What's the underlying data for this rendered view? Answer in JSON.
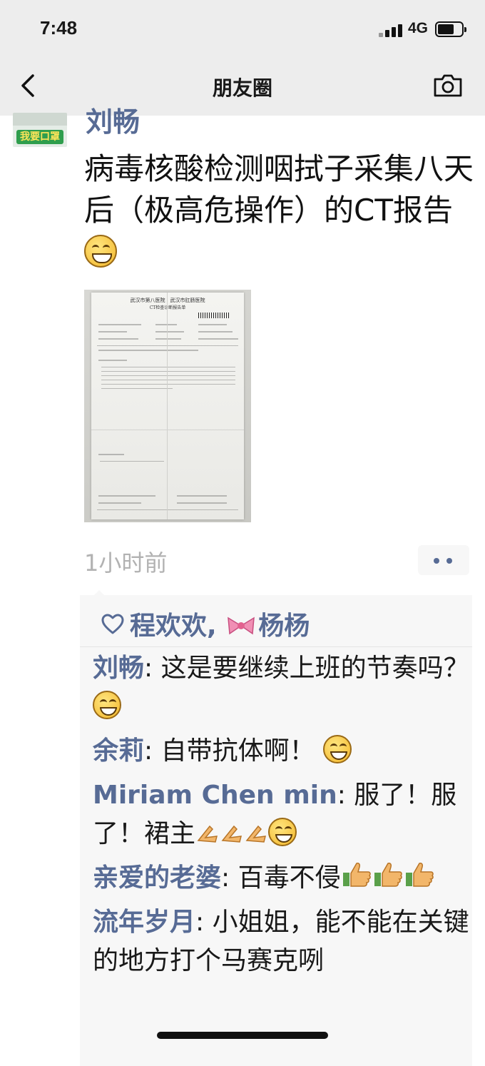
{
  "status_bar": {
    "time": "7:48",
    "network": "4G"
  },
  "nav": {
    "title": "朋友圈"
  },
  "post": {
    "avatar_label": "我要口罩",
    "author": "刘畅",
    "text": "病毒核酸检测咽拭子采集八天后（极高危操作）的CT报告",
    "time_ago": "1小时前",
    "report_header_1": "武汉市第八医院　武汉市肛肠医院",
    "report_header_2": "CT检查诊断报告单"
  },
  "likes": {
    "names": "程欢欢, ",
    "name2": "杨杨"
  },
  "comments": [
    {
      "author": "刘畅",
      "text": "这是要继续上班的节奏吗？"
    },
    {
      "author": "余莉",
      "text": "自带抗体啊！"
    },
    {
      "author": "Miriam Chen min",
      "text": "服了！服了！裙主"
    },
    {
      "author": "亲爱的老婆",
      "text": "百毒不侵"
    },
    {
      "author": "流年岁月",
      "text": "小姐姐，能不能在关键的地方打个马赛克咧"
    }
  ],
  "colors": {
    "link": "#576b95",
    "bar_bg": "#ededed",
    "comment_bg": "#f7f7f7"
  },
  "icons": [
    "back-arrow-icon",
    "camera-icon",
    "heart-icon",
    "grin-emoji-icon",
    "clap-hands-icon",
    "thumbs-up-icon",
    "bow-icon"
  ]
}
